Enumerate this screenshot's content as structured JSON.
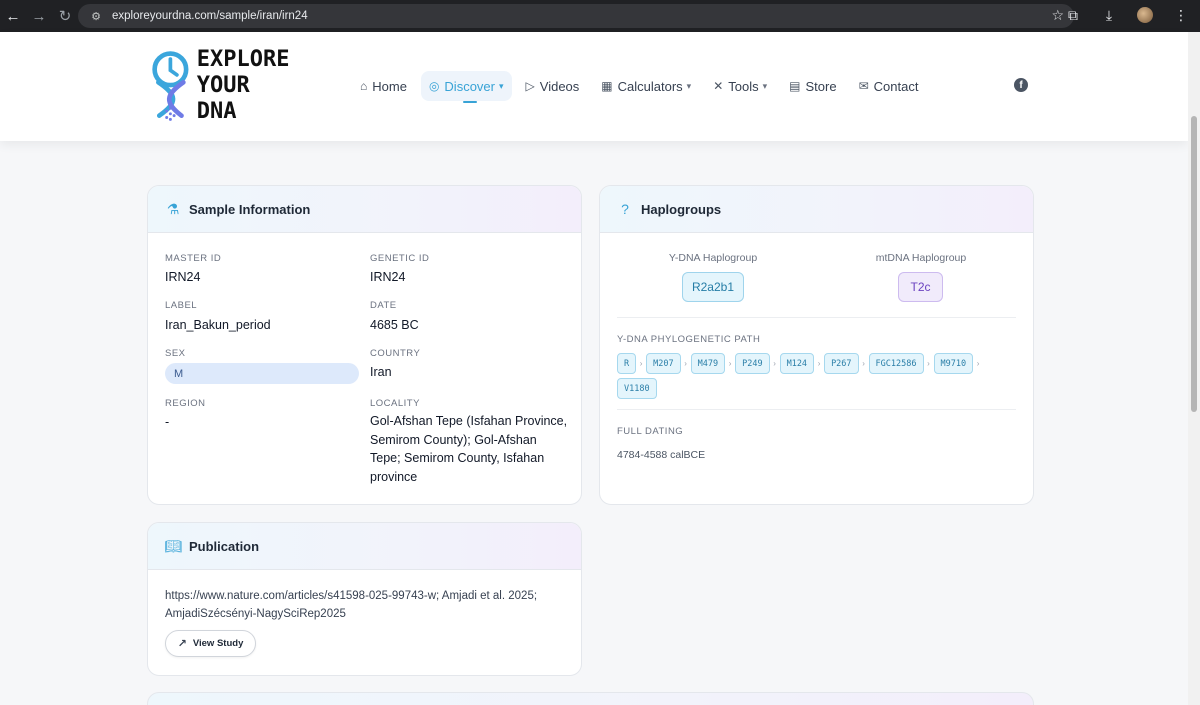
{
  "browser": {
    "url": "exploreyourdna.com/sample/iran/irn24"
  },
  "site": {
    "logo_line1": "EXPLORE",
    "logo_line2": "YOUR DNA",
    "nav": [
      {
        "label": "Home",
        "icon": "home-icon"
      },
      {
        "label": "Discover",
        "icon": "globe-icon"
      },
      {
        "label": "Videos",
        "icon": "play-circle-icon"
      },
      {
        "label": "Calculators",
        "icon": "calculator-icon"
      },
      {
        "label": "Tools",
        "icon": "tools-icon"
      },
      {
        "label": "Store",
        "icon": "store-icon"
      },
      {
        "label": "Contact",
        "icon": "mail-icon"
      }
    ],
    "accent_color": "#38a3d6"
  },
  "sample": {
    "title": "Sample Information",
    "fields": {
      "master_id_label": "MASTER ID",
      "master_id": "IRN24",
      "genetic_id_label": "GENETIC ID",
      "genetic_id": "IRN24",
      "label_label": "LABEL",
      "label": "Iran_Bakun_period",
      "date_label": "DATE",
      "date": "4685 BC",
      "sex_label": "SEX",
      "sex": "M",
      "country_label": "COUNTRY",
      "country": "Iran",
      "region_label": "REGION",
      "region": "-",
      "locality_label": "LOCALITY",
      "locality": "Gol-Afshan Tepe (Isfahan Province, Semirom County); Gol-Afshan Tepe; Semirom County, Isfahan province"
    }
  },
  "haplogroups": {
    "title": "Haplogroups",
    "ydna_label": "Y-DNA Haplogroup",
    "ydna": "R2a2b1",
    "mtdna_label": "mtDNA Haplogroup",
    "mtdna": "T2c",
    "path_label": "Y-DNA PHYLOGENETIC PATH",
    "path": [
      "R",
      "M207",
      "M479",
      "P249",
      "M124",
      "P267",
      "FGC12586",
      "M9710",
      "V1180"
    ],
    "path_separator": "›",
    "dating_label": "FULL DATING",
    "dating": "4784-4588 calBCE"
  },
  "publication": {
    "title": "Publication",
    "text": "https://www.nature.com/articles/s41598-025-99743-w; Amjadi et al. 2025; AmjadiSzécsényi-NagySciRep2025",
    "button": "View Study"
  }
}
